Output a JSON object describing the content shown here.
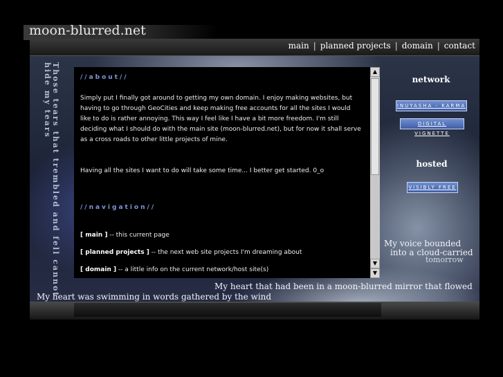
{
  "site": {
    "title": "moon-blurred.net"
  },
  "nav": {
    "items": [
      {
        "label": "main"
      },
      {
        "label": "planned projects"
      },
      {
        "label": "domain"
      },
      {
        "label": "contact"
      }
    ],
    "separator": "|"
  },
  "vertical_text": "Those tears that trembled and fell cannot hide my tears",
  "content": {
    "about": {
      "heading": "//about//",
      "paragraphs": [
        "Simply put I finally got around to getting my own domain. I enjoy making websites, but having to go through GeoCities and keep making free accounts for all the sites I would like to do is rather annoying. This way I feel like I have a bit more freedom. I'm still deciding what I should do with the main site (moon-blurred.net), but for now it shall serve as a cross roads to other little projects of mine.",
        "Having all the sites I want to do will take some time... I better get started. 0_o"
      ]
    },
    "navigation": {
      "heading": "//navigation//",
      "items": [
        {
          "label": "[ main ]",
          "desc": " -- this current page"
        },
        {
          "label": "[ planned projects ]",
          "desc": " -- the next web site projects I'm dreaming about"
        },
        {
          "label": "[ domain ]",
          "desc": " -- a little info on the current network/host site(s)"
        }
      ]
    }
  },
  "sidebar": {
    "network_heading": "network",
    "network_buttons": [
      {
        "label": "INUYASHA - KARMA"
      },
      {
        "label": "DIGITAL VIGNETTE"
      }
    ],
    "hosted_heading": "hosted",
    "hosted_buttons": [
      {
        "label": "VISIBLY FREE"
      }
    ]
  },
  "poem": {
    "line_right_1": "My voice bounded",
    "line_right_2": "into a cloud-carried",
    "line_right_3": "tomorrow",
    "line_mid": "My heart that had been in a moon-blurred mirror that flowed",
    "line_bottom": "My heart was swimming in words gathered by the wind"
  },
  "colors": {
    "accent": "#7d98d8",
    "button": "#4f6fc0",
    "background": "#000000"
  }
}
